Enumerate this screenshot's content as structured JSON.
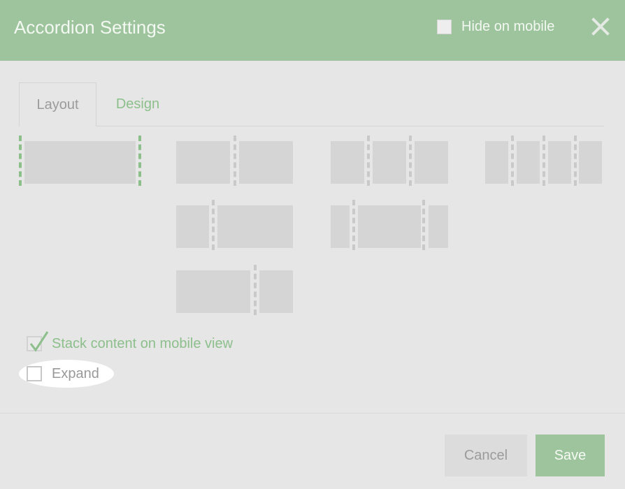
{
  "header": {
    "title": "Accordion Settings",
    "hide_on_mobile": {
      "label": "Hide on mobile",
      "checked": false
    },
    "close_icon": "close-x-icon"
  },
  "tabs": [
    {
      "label": "Layout",
      "active": true
    },
    {
      "label": "Design",
      "active": false
    }
  ],
  "layouts": [
    {
      "id": "1-col",
      "ratio": "1",
      "selected": true
    },
    {
      "id": "2-col-equal",
      "ratio": "1/2 + 1/2",
      "selected": false
    },
    {
      "id": "3-col-equal",
      "ratio": "1/3 + 1/3 + 1/3",
      "selected": false
    },
    {
      "id": "4-col-equal",
      "ratio": "1/4 + 1/4 + 1/4 + 1/4",
      "selected": false
    },
    {
      "id": "2-col-narrow-wide",
      "ratio": "1/3 + 2/3",
      "selected": false
    },
    {
      "id": "3-col-wide-center",
      "ratio": "1/4 + 1/2 + 1/4",
      "selected": false
    },
    {
      "id": "2-col-wide-narrow",
      "ratio": "2/3 + 1/3",
      "selected": false
    }
  ],
  "options": {
    "stack_mobile": {
      "label": "Stack content on mobile view",
      "checked": true
    },
    "expand": {
      "label": "Expand",
      "checked": false
    }
  },
  "footer": {
    "cancel_label": "Cancel",
    "save_label": "Save"
  },
  "colors": {
    "accent": "#9dc49c",
    "accent_text": "#8cbf8b",
    "background": "#e6e6e6",
    "layout_block": "#d5d5d5"
  }
}
